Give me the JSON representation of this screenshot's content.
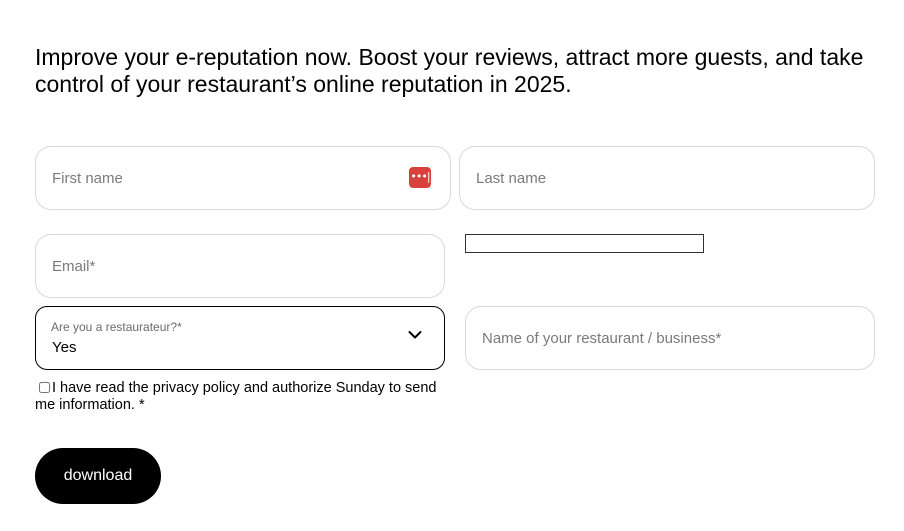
{
  "intro": {
    "text": "Improve your e-reputation now. Boost your reviews, attract more guests, and take control of your restaurant’s online reputation in 2025."
  },
  "form": {
    "first_name": {
      "placeholder": "First name",
      "value": ""
    },
    "last_name": {
      "placeholder": "Last name",
      "value": ""
    },
    "email": {
      "placeholder": "Email*",
      "value": ""
    },
    "restaurateur": {
      "label": "Are you a restaurateur?*",
      "value": "Yes"
    },
    "restaurant_name": {
      "placeholder": "Name of your restaurant / business*",
      "value": ""
    },
    "consent": {
      "text": "I have read the privacy policy and authorize Sunday to send me information. *",
      "checked": false
    },
    "submit_label": "download"
  },
  "icons": {
    "password_manager": "password-manager-icon",
    "select_chevron": "chevron-down-icon"
  },
  "colors": {
    "primary_button_bg": "#000000",
    "primary_button_text": "#ffffff",
    "field_border": "#d9d9d9",
    "password_icon_bg": "#d9413c"
  }
}
